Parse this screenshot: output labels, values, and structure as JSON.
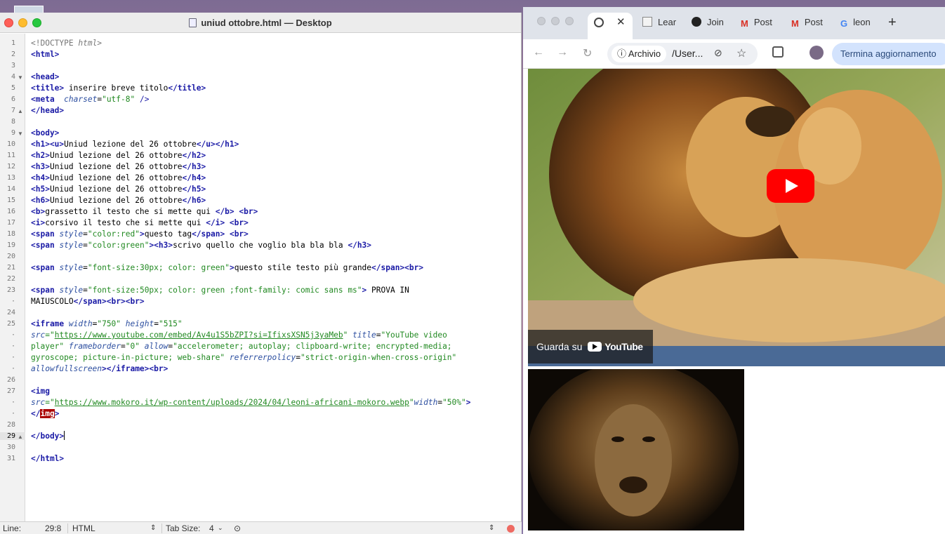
{
  "editor": {
    "title": "uniud ottobre.html — Desktop",
    "lines": [
      {
        "n": "1"
      },
      {
        "n": "2"
      },
      {
        "n": "3"
      },
      {
        "n": "4"
      },
      {
        "n": "5"
      },
      {
        "n": "6"
      },
      {
        "n": "7"
      },
      {
        "n": "8"
      },
      {
        "n": "9"
      },
      {
        "n": "10"
      },
      {
        "n": "11"
      },
      {
        "n": "12"
      },
      {
        "n": "13"
      },
      {
        "n": "14"
      },
      {
        "n": "15"
      },
      {
        "n": "16"
      },
      {
        "n": "17"
      },
      {
        "n": "18"
      },
      {
        "n": "19"
      },
      {
        "n": "20"
      },
      {
        "n": "21"
      },
      {
        "n": "22"
      },
      {
        "n": "23"
      },
      {
        "n": "24"
      },
      {
        "n": "25"
      },
      {
        "n": "26"
      },
      {
        "n": "27"
      },
      {
        "n": "28"
      },
      {
        "n": "29"
      },
      {
        "n": "30"
      },
      {
        "n": "31"
      }
    ],
    "code": {
      "l1_doctype": "<!DOCTYPE",
      "l1_html": " html>",
      "l2": "<html>",
      "l4": "<head>",
      "l5_open": "<title>",
      "l5_text": " inserire breve titolo",
      "l5_close": "</title>",
      "l6_meta": "<meta",
      "l6_attr": "charset",
      "l6_eq": "=",
      "l6_val": "\"utf-8\"",
      "l6_end": " />",
      "l7": "</head>",
      "l9": "<body>",
      "l10_open": "<h1><u>",
      "l10_text": "Uniud lezione del 26 ottobre",
      "l10_close": "</u></h1>",
      "l11_open": "<h2>",
      "l11_text": "Uniud lezione del 26 ottobre",
      "l11_close": "</h2>",
      "l12_open": "<h3>",
      "l12_text": "Uniud lezione del 26 ottobre",
      "l12_close": "</h3>",
      "l13_open": "<h4>",
      "l13_text": "Uniud lezione del 26 ottobre",
      "l13_close": "</h4>",
      "l14_open": "<h5>",
      "l14_text": "Uniud lezione del 26 ottobre",
      "l14_close": "</h5>",
      "l15_open": "<h6>",
      "l15_text": "Uniud lezione del 26 ottobre",
      "l15_close": "</h6>",
      "l16_open": "<b>",
      "l16_text": "grassetto il testo che si mette qui ",
      "l16_close": "</b> <br>",
      "l17_open": "<i>",
      "l17_text": "corsivo il testo che si mette qui ",
      "l17_close": "</i> <br>",
      "l18_span": "<span",
      "l18_attr": "style",
      "l18_val": "\"color:red\"",
      "l18_gt": ">",
      "l18_text": "questo tag",
      "l18_close": "</span> <br>",
      "l19_span": "<span",
      "l19_attr": "style",
      "l19_val": "\"color:green\"",
      "l19_gt": "><h3>",
      "l19_text": "scrivo quello che voglio bla bla bla ",
      "l19_close": "</h3>",
      "l21_span": "<span",
      "l21_attr": "style",
      "l21_val": "\"font-size:30px; color: green\"",
      "l21_gt": ">",
      "l21_text": "questo stile testo più grande",
      "l21_close": "</span><br>",
      "l23_span": "<span",
      "l23_attr": "style",
      "l23_val": "\"font-size:50px; color: green ;font-family: comic sans ms\"",
      "l23_gt": ">",
      "l23_text": " PROVA IN",
      "l23b_text": "MAIUSCOLO",
      "l23b_close": "</span><br><br>",
      "l25_tag": "<iframe",
      "l25_a1": "width",
      "l25_v1": "\"750\"",
      "l25_a2": "height",
      "l25_v2": "\"515\"",
      "l25b_a": "src",
      "l25b_q": "=\"",
      "l25b_url": "https://www.youtube.com/embed/Av4u1S5bZPI?si=IfixsXSN5j3yaMeb",
      "l25b_q2": "\"",
      "l25b_a2": "title",
      "l25b_v2": "\"YouTube video",
      "l25c_v": "player\"",
      "l25c_a1": "frameborder",
      "l25c_v1": "\"0\"",
      "l25c_a2": "allow",
      "l25c_v2": "\"accelerometer; autoplay; clipboard-write; encrypted-media;",
      "l25d_v": "gyroscope; picture-in-picture; web-share\"",
      "l25d_a": "referrerpolicy",
      "l25d_v2": "\"strict-origin-when-cross-origin\"",
      "l25e_a": "allowfullscreen",
      "l25e_close": "></iframe><br>",
      "l27_tag": "<img",
      "l27b_a": "src",
      "l27b_q": "=\"",
      "l27b_url": "https://www.mokoro.it/wp-content/uploads/2024/04/leoni-africani-mokoro.webp",
      "l27b_q2": "\"",
      "l27b_a2": "width",
      "l27b_v2": "\"50%\"",
      "l27b_gt": ">",
      "l27c_open": "</",
      "l27c_img": "img",
      "l27c_gt": ">",
      "l29": "</body>",
      "l31": "</html>"
    }
  },
  "status": {
    "line_label": "Line:",
    "line_value": "29:8",
    "language": "HTML",
    "tab_label": "Tab Size:",
    "tab_value": "4"
  },
  "browser": {
    "tabs": [
      "Lear",
      "Join",
      "Post",
      "Post",
      "leon"
    ],
    "new_tab": "+",
    "address_chip": "Archivio",
    "url": "/User...",
    "update_button": "Termina aggiornamento",
    "watch_on": "Guarda su",
    "yt_brand": "YouTube"
  }
}
